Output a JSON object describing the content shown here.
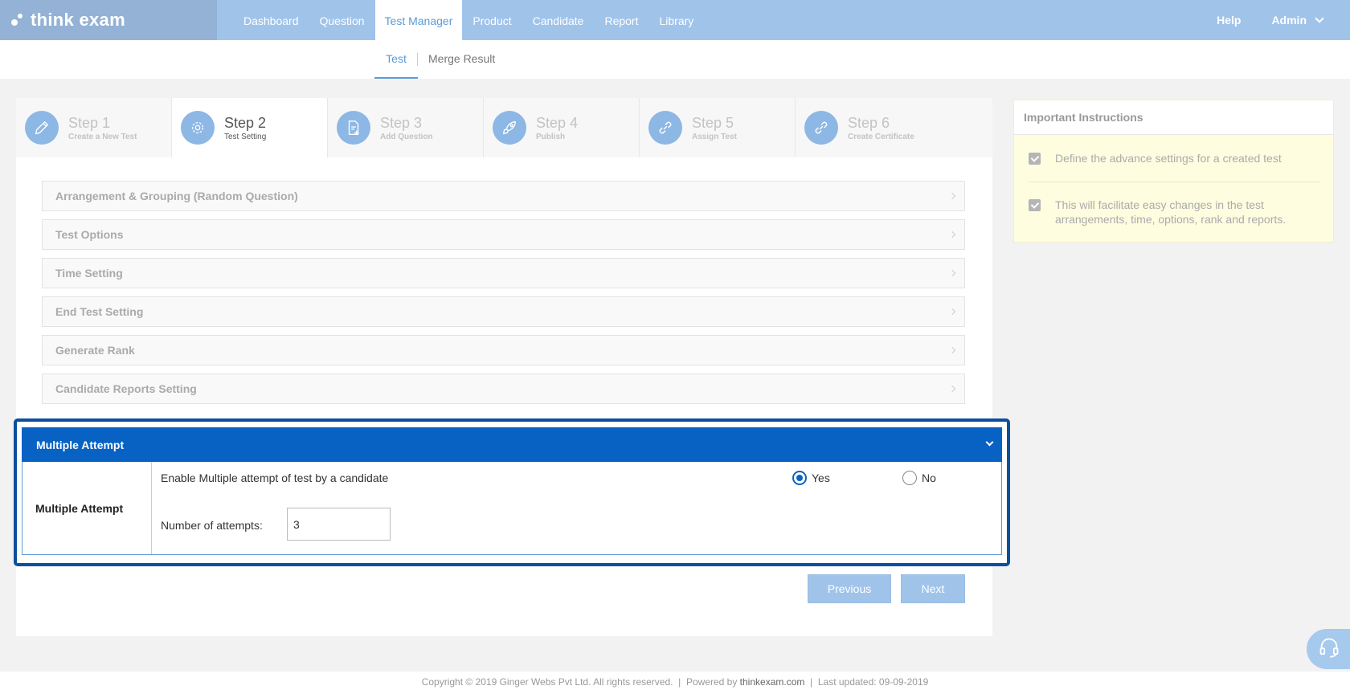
{
  "app": {
    "logo_text": "think exam"
  },
  "nav": {
    "items": [
      {
        "label": "Dashboard"
      },
      {
        "label": "Question"
      },
      {
        "label": "Test Manager"
      },
      {
        "label": "Product"
      },
      {
        "label": "Candidate"
      },
      {
        "label": "Report"
      },
      {
        "label": "Library"
      }
    ],
    "active": "Test Manager",
    "help": "Help",
    "user": "Admin"
  },
  "subnav": {
    "items": [
      {
        "label": "Test"
      },
      {
        "label": "Merge Result"
      }
    ],
    "active": "Test"
  },
  "steps": [
    {
      "title": "Step 1",
      "subtitle": "Create a New Test",
      "icon": "pencil-icon"
    },
    {
      "title": "Step 2",
      "subtitle": "Test Setting",
      "icon": "gear-icon"
    },
    {
      "title": "Step 3",
      "subtitle": "Add Question",
      "icon": "add-document-icon"
    },
    {
      "title": "Step 4",
      "subtitle": "Publish",
      "icon": "rocket-icon"
    },
    {
      "title": "Step 5",
      "subtitle": "Assign Test",
      "icon": "link-icon"
    },
    {
      "title": "Step 6",
      "subtitle": "Create Certificate",
      "icon": "link-icon"
    }
  ],
  "active_step": "Step 2",
  "sections": [
    {
      "label": "Arrangement & Grouping (Random Question)"
    },
    {
      "label": "Test Options"
    },
    {
      "label": "Time Setting"
    },
    {
      "label": "End Test Setting"
    },
    {
      "label": "Generate Rank"
    },
    {
      "label": "Candidate Reports Setting"
    }
  ],
  "multiple_attempt": {
    "header": "Multiple Attempt",
    "row_label": "Multiple Attempt",
    "description": "Enable Multiple attempt of test by a candidate",
    "options": [
      {
        "label": "Yes",
        "selected": true
      },
      {
        "label": "No",
        "selected": false
      }
    ],
    "attempts_label": "Number of attempts:",
    "attempts_value": "3"
  },
  "buttons": {
    "previous": "Previous",
    "next": "Next"
  },
  "instructions": {
    "title": "Important Instructions",
    "items": [
      "Define the advance settings for a created test",
      "This will facilitate easy changes in the test arrangements, time, options, rank and reports."
    ]
  },
  "footer": {
    "copyright": "Copyright © 2019 Ginger Webs Pvt Ltd. All rights reserved.",
    "sep1": "|",
    "powered_prefix": "Powered by",
    "powered_link": "thinkexam.com",
    "sep2": "|",
    "last_updated": "Last updated: 09-09-2019"
  },
  "colors": {
    "nav_bg": "#a0c3ea",
    "accent": "#0762c4",
    "highlight_border": "#0b4f9c",
    "instructions_bg": "#fffde0"
  }
}
